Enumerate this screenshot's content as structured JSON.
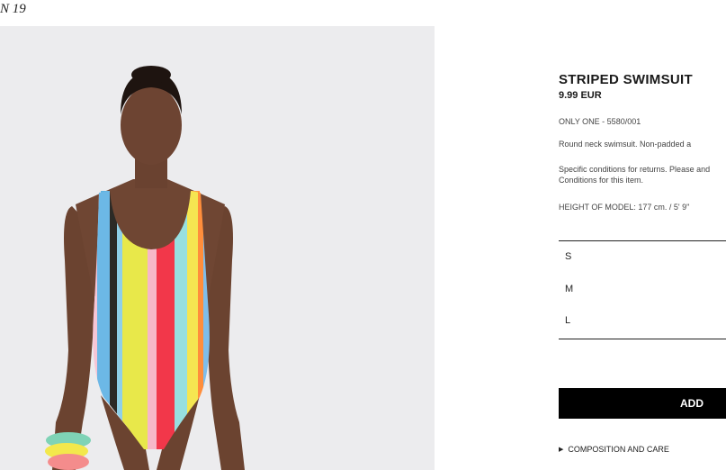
{
  "header": {
    "season_tag": "N 19"
  },
  "product": {
    "title": "STRIPED SWIMSUIT",
    "price": "9.99 EUR",
    "reference": "ONLY ONE - 5580/001",
    "description": "Round neck swimsuit. Non-padded a",
    "returns_note": "Specific conditions for returns. Please and Conditions for this item.",
    "model_height": "HEIGHT OF MODEL: 177 cm. / 5' 9\""
  },
  "sizes": [
    "S",
    "M",
    "L"
  ],
  "actions": {
    "add_label": "ADD"
  },
  "accordion": {
    "composition_label": "COMPOSITION AND CARE"
  },
  "colors": {
    "photo_background": "#ececee",
    "button_background": "#000000",
    "button_text": "#ffffff"
  }
}
